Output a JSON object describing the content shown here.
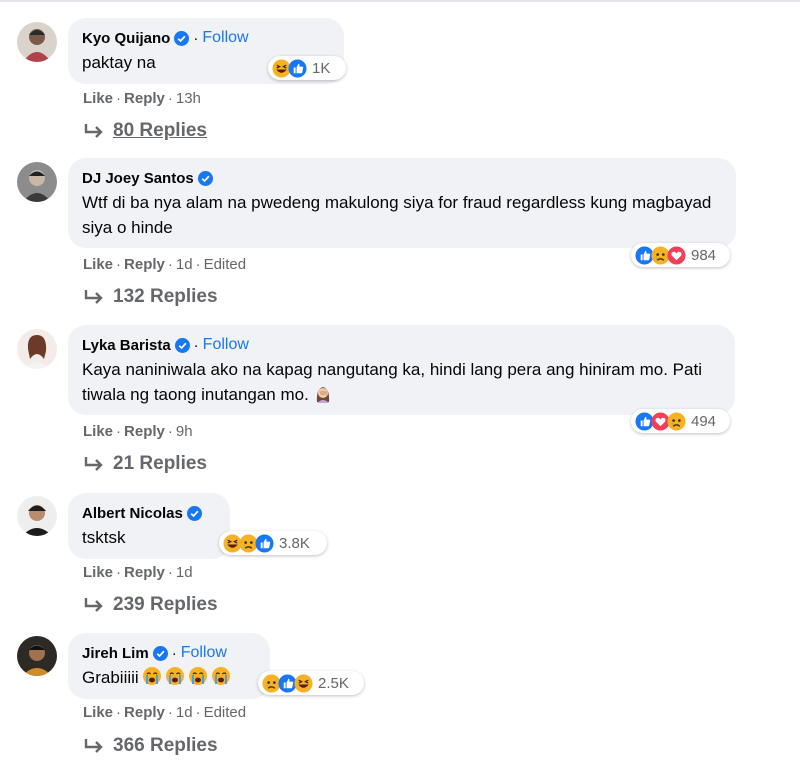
{
  "ui": {
    "follow_label": "Follow",
    "like_label": "Like",
    "reply_label": "Reply",
    "dot": "·"
  },
  "comments": [
    {
      "author": "Kyo Quijano",
      "verified": true,
      "show_follow": true,
      "text": "paktay na",
      "reactions": [
        "haha-icon",
        "like-icon"
      ],
      "reaction_count": "1K",
      "time": "13h",
      "edited": "",
      "replies_label": "80 Replies"
    },
    {
      "author": "DJ Joey Santos",
      "verified": true,
      "show_follow": false,
      "text": "Wtf di ba nya alam na pwedeng makulong siya for fraud regardless kung magbayad siya o hinde",
      "reactions": [
        "like-icon",
        "sad-icon",
        "love-icon"
      ],
      "reaction_count": "984",
      "time": "1d",
      "edited": "Edited",
      "replies_label": "132 Replies"
    },
    {
      "author": "Lyka Barista",
      "verified": true,
      "show_follow": true,
      "text": "Kaya naniniwala ako na kapag nangutang ka, hindi lang pera ang hiniram mo. Pati tiwala ng taong inutangan mo.",
      "inline_emoji": "woman-facepalm-icon",
      "reactions": [
        "like-icon",
        "love-icon",
        "sad-icon"
      ],
      "reaction_count": "494",
      "time": "9h",
      "edited": "",
      "replies_label": "21 Replies"
    },
    {
      "author": "Albert Nicolas",
      "verified": true,
      "show_follow": false,
      "text": "tsktsk",
      "reactions": [
        "haha-icon",
        "sad-icon",
        "like-icon"
      ],
      "reaction_count": "3.8K",
      "time": "1d",
      "edited": "",
      "replies_label": "239 Replies"
    },
    {
      "author": "Jireh Lim",
      "verified": true,
      "show_follow": true,
      "text": "Grabiiiii",
      "inline_emoji": "loudly-crying-icon",
      "inline_emoji_count": 4,
      "reactions": [
        "sad-icon",
        "like-icon",
        "haha-icon"
      ],
      "reaction_count": "2.5K",
      "time": "1d",
      "edited": "Edited",
      "replies_label": "366 Replies"
    }
  ],
  "colors": {
    "link": "#1877f2",
    "bubble": "#f0f2f5",
    "meta": "#65676b"
  }
}
